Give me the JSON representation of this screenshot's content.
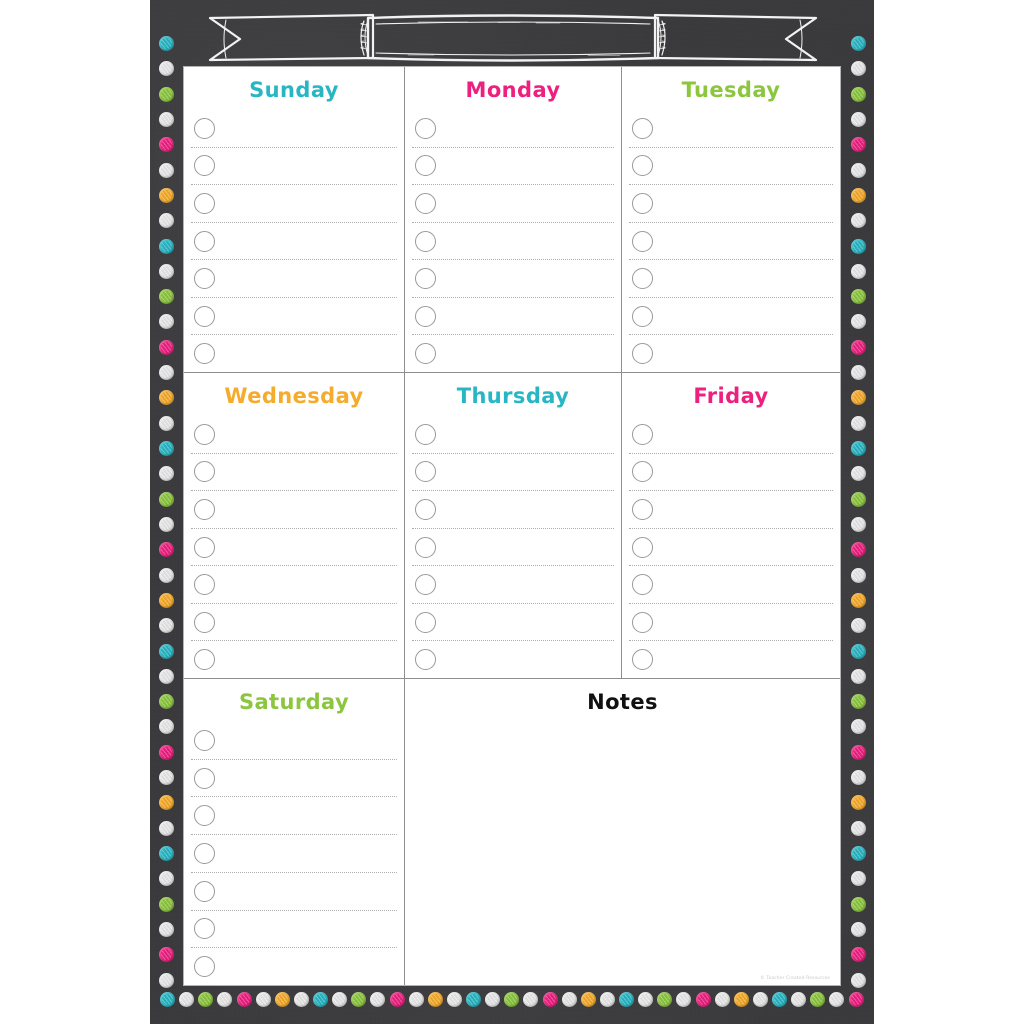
{
  "document": {
    "type": "weekly-planner-chart",
    "banner_text": "",
    "copyright": "© Teacher Created Resources"
  },
  "colors": {
    "chalkboard": "#3a3a3c",
    "paper": "#ffffff",
    "teal": "#29b6c4",
    "magenta": "#ed1f7f",
    "lime": "#8cc63e",
    "orange": "#f5ab2b",
    "white_dot": "#e8e8e8",
    "black": "#111111",
    "rule_line": "#adadad",
    "circle_outline": "#9a9a9a"
  },
  "grid": {
    "rows": [
      {
        "cells": [
          {
            "label": "Sunday",
            "color": "#29b6c4",
            "task_rows": 7,
            "kind": "day"
          },
          {
            "label": "Monday",
            "color": "#ed1f7f",
            "task_rows": 7,
            "kind": "day"
          },
          {
            "label": "Tuesday",
            "color": "#8cc63e",
            "task_rows": 7,
            "kind": "day"
          }
        ]
      },
      {
        "cells": [
          {
            "label": "Wednesday",
            "color": "#f5ab2b",
            "task_rows": 7,
            "kind": "day"
          },
          {
            "label": "Thursday",
            "color": "#29b6c4",
            "task_rows": 7,
            "kind": "day"
          },
          {
            "label": "Friday",
            "color": "#ed1f7f",
            "task_rows": 7,
            "kind": "day"
          }
        ]
      },
      {
        "cells": [
          {
            "label": "Saturday",
            "color": "#8cc63e",
            "task_rows": 7,
            "kind": "day"
          },
          {
            "label": "Notes",
            "color": "#111111",
            "task_rows": 0,
            "kind": "notes"
          }
        ]
      }
    ]
  },
  "border_dots": {
    "pattern": [
      "#29b6c4",
      "#e8e8e8",
      "#8cc63e",
      "#e8e8e8",
      "#ed1f7f",
      "#e8e8e8",
      "#f5ab2b",
      "#e8e8e8"
    ],
    "left_count": 38,
    "right_count": 38,
    "bottom_count": 37
  },
  "labels": {
    "sunday": "Sunday",
    "monday": "Monday",
    "tuesday": "Tuesday",
    "wednesday": "Wednesday",
    "thursday": "Thursday",
    "friday": "Friday",
    "saturday": "Saturday",
    "notes": "Notes"
  }
}
